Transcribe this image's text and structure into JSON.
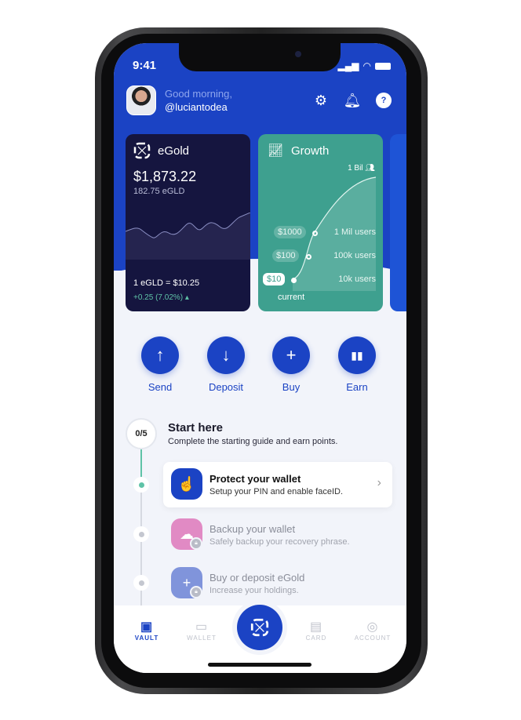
{
  "status": {
    "time": "9:41"
  },
  "header": {
    "greeting": "Good morning,",
    "username": "@luciantodea"
  },
  "cards": {
    "egold": {
      "title": "eGold",
      "balance": "$1,873.22",
      "amount": "182.75 eGLD",
      "rate": "1 eGLD = $10.25",
      "change": "+0.25 (7.02%) ▴"
    },
    "growth": {
      "title": "Growth",
      "top": "1 Bil",
      "levels": [
        {
          "price": "$1000",
          "users": "1 Mil users"
        },
        {
          "price": "$100",
          "users": "100k users"
        },
        {
          "price": "$10",
          "users": "10k users"
        }
      ],
      "current": "current"
    }
  },
  "actions": [
    {
      "label": "Send",
      "icon": "arrow-up"
    },
    {
      "label": "Deposit",
      "icon": "arrow-down"
    },
    {
      "label": "Buy",
      "icon": "plus"
    },
    {
      "label": "Earn",
      "icon": "bar-chart"
    }
  ],
  "guide": {
    "progress": "0/5",
    "title": "Start here",
    "subtitle": "Complete the starting guide and earn points.",
    "items": [
      {
        "title": "Protect your wallet",
        "subtitle": "Setup your PIN and enable faceID.",
        "locked": false,
        "color": "#1b43c4"
      },
      {
        "title": "Backup your wallet",
        "subtitle": "Safely backup your recovery phrase.",
        "locked": true,
        "color": "#e18ac4"
      },
      {
        "title": "Buy or deposit eGold",
        "subtitle": "Increase your holdings.",
        "locked": true,
        "color": "#8094db"
      }
    ]
  },
  "nav": [
    {
      "label": "VAULT",
      "active": true
    },
    {
      "label": "WALLET"
    },
    {
      "label": "CARD"
    },
    {
      "label": "ACCOUNT"
    }
  ],
  "colors": {
    "primary": "#1b43c4",
    "growth": "#3ea08f",
    "egold_card": "#15153f"
  }
}
